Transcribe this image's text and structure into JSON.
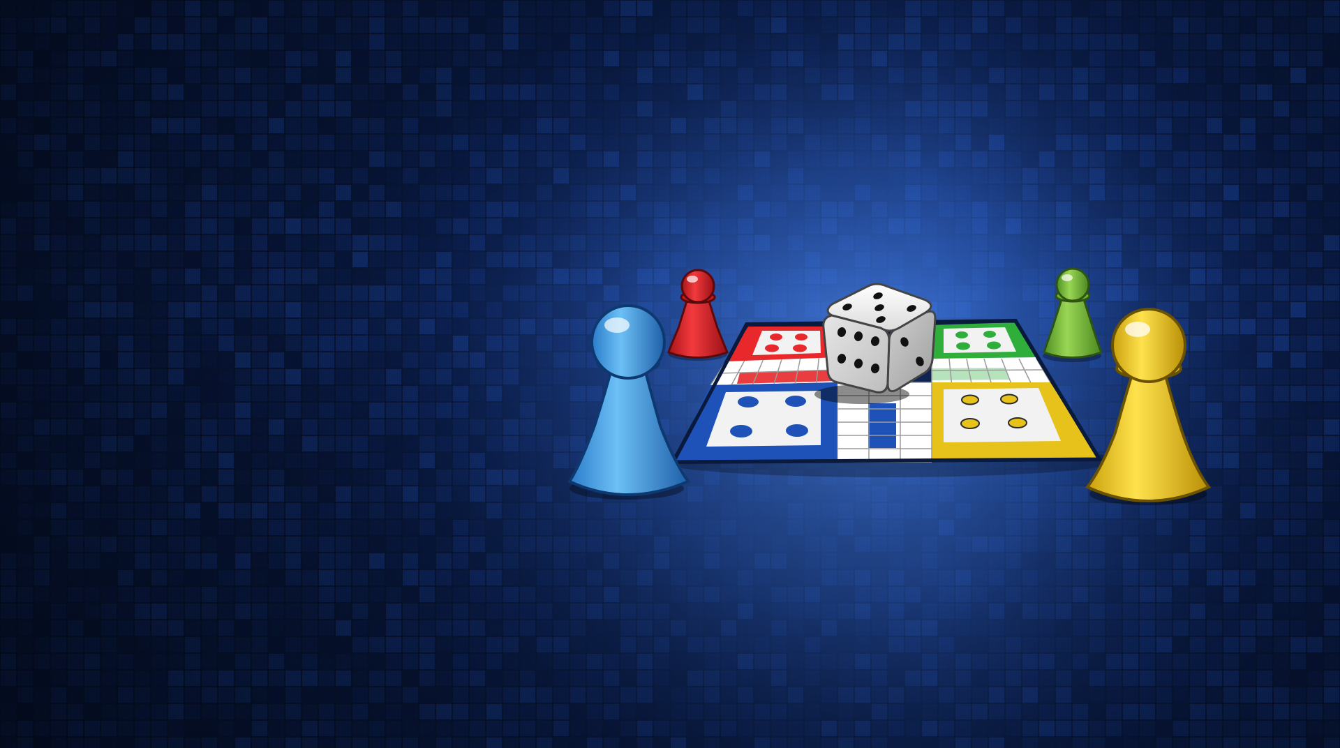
{
  "scene": {
    "background": {
      "pattern": "blue-pixel-mosaic",
      "glow_color": "#3f7ae0",
      "base_color": "#0b1a3c",
      "tile_colors": [
        "#0f2a6b",
        "#12327d",
        "#0d255f",
        "#163b8f",
        "#0a1f52",
        "#1a44a0"
      ]
    },
    "board": {
      "quadrant_colors": {
        "red": "#e8282b",
        "green": "#2fae3c",
        "blue": "#1e52b8",
        "yellow": "#e6c21a"
      },
      "track_color": "#ffffff"
    },
    "die": {
      "face_top_pips": 5,
      "face_left_pips": 6,
      "face_right_pips": 2,
      "color": "#e9e9e9",
      "pip_color": "#111111"
    },
    "pawns": [
      {
        "name": "blue",
        "color": "#49a7ea",
        "size": "large"
      },
      {
        "name": "red",
        "color": "#e01f24",
        "size": "small"
      },
      {
        "name": "green",
        "color": "#7cc23a",
        "size": "small"
      },
      {
        "name": "yellow",
        "color": "#f3cc1c",
        "size": "large"
      }
    ]
  }
}
